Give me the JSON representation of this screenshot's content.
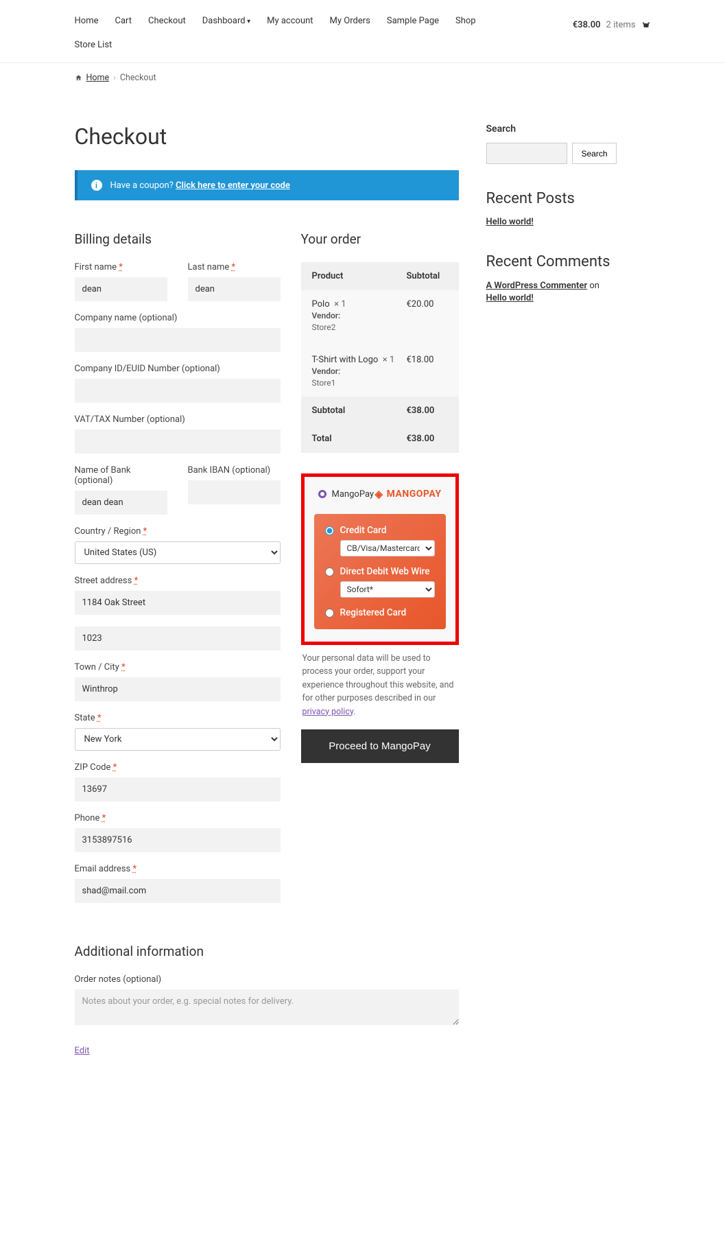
{
  "nav": {
    "items": [
      "Home",
      "Cart",
      "Checkout",
      "Dashboard",
      "My account",
      "My Orders",
      "Sample Page",
      "Shop"
    ],
    "row2": "Store List",
    "cart_amount": "€38.00",
    "cart_items": "2 items"
  },
  "breadcrumb": {
    "home": "Home",
    "current": "Checkout"
  },
  "page_title": "Checkout",
  "coupon": {
    "text": "Have a coupon?",
    "link": "Click here to enter your code"
  },
  "billing": {
    "heading": "Billing details",
    "first_name_label": "First name",
    "first_name": "dean",
    "last_name_label": "Last name",
    "last_name": "dean",
    "company_label": "Company name (optional)",
    "company": "",
    "company_id_label": "Company ID/EUID Number (optional)",
    "company_id": "",
    "vat_label": "VAT/TAX Number (optional)",
    "vat": "",
    "bank_label": "Name of Bank (optional)",
    "bank": "dean dean",
    "iban_label": "Bank IBAN (optional)",
    "iban": "",
    "country_label": "Country / Region",
    "country": "United States (US)",
    "street_label": "Street address",
    "street1": "1184 Oak Street",
    "street2": "1023",
    "city_label": "Town / City",
    "city": "Winthrop",
    "state_label": "State",
    "state": "New York",
    "zip_label": "ZIP Code",
    "zip": "13697",
    "phone_label": "Phone",
    "phone": "3153897516",
    "email_label": "Email address",
    "email": "shad@mail.com"
  },
  "additional": {
    "heading": "Additional information",
    "notes_label": "Order notes (optional)",
    "notes_placeholder": "Notes about your order, e.g. special notes for delivery."
  },
  "order": {
    "heading": "Your order",
    "product_col": "Product",
    "subtotal_col": "Subtotal",
    "items": [
      {
        "name": "Polo",
        "qty": "× 1",
        "subtotal": "€20.00",
        "vendor_label": "Vendor:",
        "vendor": "Store2"
      },
      {
        "name": "T-Shirt with Logo",
        "qty": "× 1",
        "subtotal": "€18.00",
        "vendor_label": "Vendor:",
        "vendor": "Store1"
      }
    ],
    "subtotal_label": "Subtotal",
    "subtotal_value": "€38.00",
    "total_label": "Total",
    "total_value": "€38.00"
  },
  "payment": {
    "gateway": "MangoPay",
    "logo_text": "MANGOPAY",
    "credit_card_label": "Credit Card",
    "credit_card_select": "CB/Visa/Mastercard",
    "debit_label": "Direct Debit Web Wire",
    "debit_select": "Sofort*",
    "registered_label": "Registered Card",
    "privacy_text": "Your personal data will be used to process your order, support your experience throughout this website, and for other purposes described in our ",
    "privacy_link": "privacy policy",
    "proceed_label": "Proceed to MangoPay"
  },
  "sidebar": {
    "search_heading": "Search",
    "search_button": "Search",
    "recent_posts_heading": "Recent Posts",
    "recent_post": "Hello world!",
    "recent_comments_heading": "Recent Comments",
    "commenter": "A WordPress Commenter",
    "on_word": " on ",
    "commented_post": "Hello world!"
  },
  "edit_link": "Edit"
}
